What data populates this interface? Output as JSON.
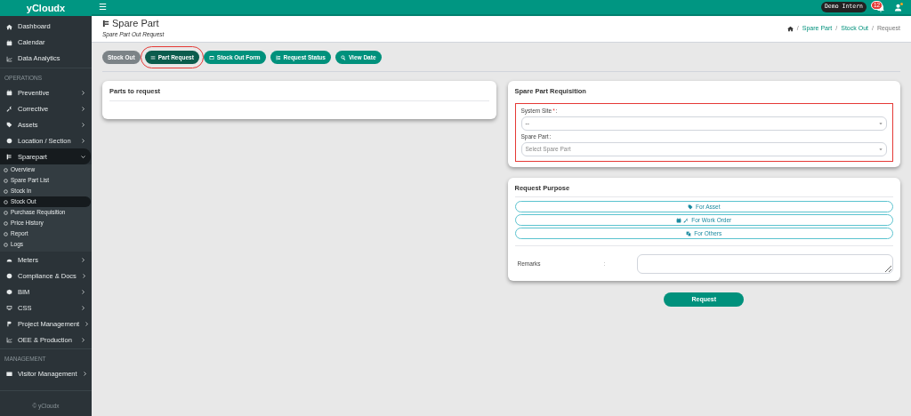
{
  "brand": "yCloudx",
  "sidebar": {
    "items": [
      {
        "kind": "item",
        "label": "Dashboard",
        "selected": false
      },
      {
        "kind": "item",
        "label": "Calendar",
        "selected": false
      },
      {
        "kind": "item",
        "label": "Data Analytics",
        "selected": false
      },
      {
        "kind": "section",
        "label": "OPERATIONS"
      },
      {
        "kind": "group",
        "label": "Preventive",
        "expanded": false,
        "selected": false
      },
      {
        "kind": "group",
        "label": "Corrective",
        "expanded": false,
        "selected": false
      },
      {
        "kind": "group",
        "label": "Assets",
        "expanded": false,
        "selected": false
      },
      {
        "kind": "group",
        "label": "Location / Section",
        "expanded": false,
        "selected": false
      },
      {
        "kind": "group",
        "label": "Sparepart",
        "expanded": true,
        "selected": true,
        "children": [
          {
            "label": "Overview",
            "selected": false
          },
          {
            "label": "Spare Part List",
            "selected": false
          },
          {
            "label": "Stock In",
            "selected": false
          },
          {
            "label": "Stock Out",
            "selected": true
          },
          {
            "label": "Purchase Requisition",
            "selected": false
          },
          {
            "label": "Price History",
            "selected": false
          },
          {
            "label": "Report",
            "selected": false
          },
          {
            "label": "Logs",
            "selected": false
          }
        ]
      },
      {
        "kind": "group",
        "label": "Meters",
        "expanded": false,
        "selected": false
      },
      {
        "kind": "group",
        "label": "Compliance & Docs",
        "expanded": false,
        "selected": false
      },
      {
        "kind": "group",
        "label": "BIM",
        "expanded": false,
        "selected": false
      },
      {
        "kind": "group",
        "label": "CSS",
        "expanded": false,
        "selected": false
      },
      {
        "kind": "group",
        "label": "Project Management",
        "expanded": false,
        "selected": false
      },
      {
        "kind": "group",
        "label": "OEE & Production",
        "expanded": false,
        "selected": false
      },
      {
        "kind": "section",
        "label": "MANAGEMENT"
      },
      {
        "kind": "group",
        "label": "Visitor Management",
        "expanded": false,
        "selected": false
      }
    ],
    "footer": "© yCloudx"
  },
  "topbar": {
    "menu_glyph": "☰",
    "user_chip": "Demo Intern",
    "notification_count": "12"
  },
  "header": {
    "title": "Spare Part",
    "subtitle": "Spare Part Out Request",
    "breadcrumb": [
      {
        "separator": "/",
        "label": "Spare Part"
      },
      {
        "separator": "/",
        "label": "Stock Out"
      },
      {
        "separator": "/",
        "label": "Request"
      }
    ]
  },
  "tabs": [
    {
      "label": "Stock Out",
      "selected": false,
      "highlighted": false
    },
    {
      "label": "Part Request",
      "selected": true,
      "highlighted": true
    },
    {
      "label": "Stock Out Form",
      "selected": false,
      "highlighted": false
    },
    {
      "label": "Request Status",
      "selected": false,
      "highlighted": false
    },
    {
      "label": "View Date",
      "selected": false,
      "highlighted": false
    }
  ],
  "parts_card": {
    "title": "Parts to request"
  },
  "requisition": {
    "title": "Spare Part Requisition",
    "highlighted": true,
    "fields": [
      {
        "label": "System Site",
        "required_mark": "*",
        "suffix": ":",
        "value": "--"
      },
      {
        "label": "Spare Part",
        "suffix": ":",
        "placeholder": "Select Spare Part"
      }
    ]
  },
  "purpose": {
    "title": "Request Purpose",
    "options": [
      {
        "label": "For Asset"
      },
      {
        "label": "For Work Order"
      },
      {
        "label": "For Others"
      }
    ],
    "remarks_label": "Remarks",
    "remarks_separator": ":"
  },
  "submit": "Request"
}
